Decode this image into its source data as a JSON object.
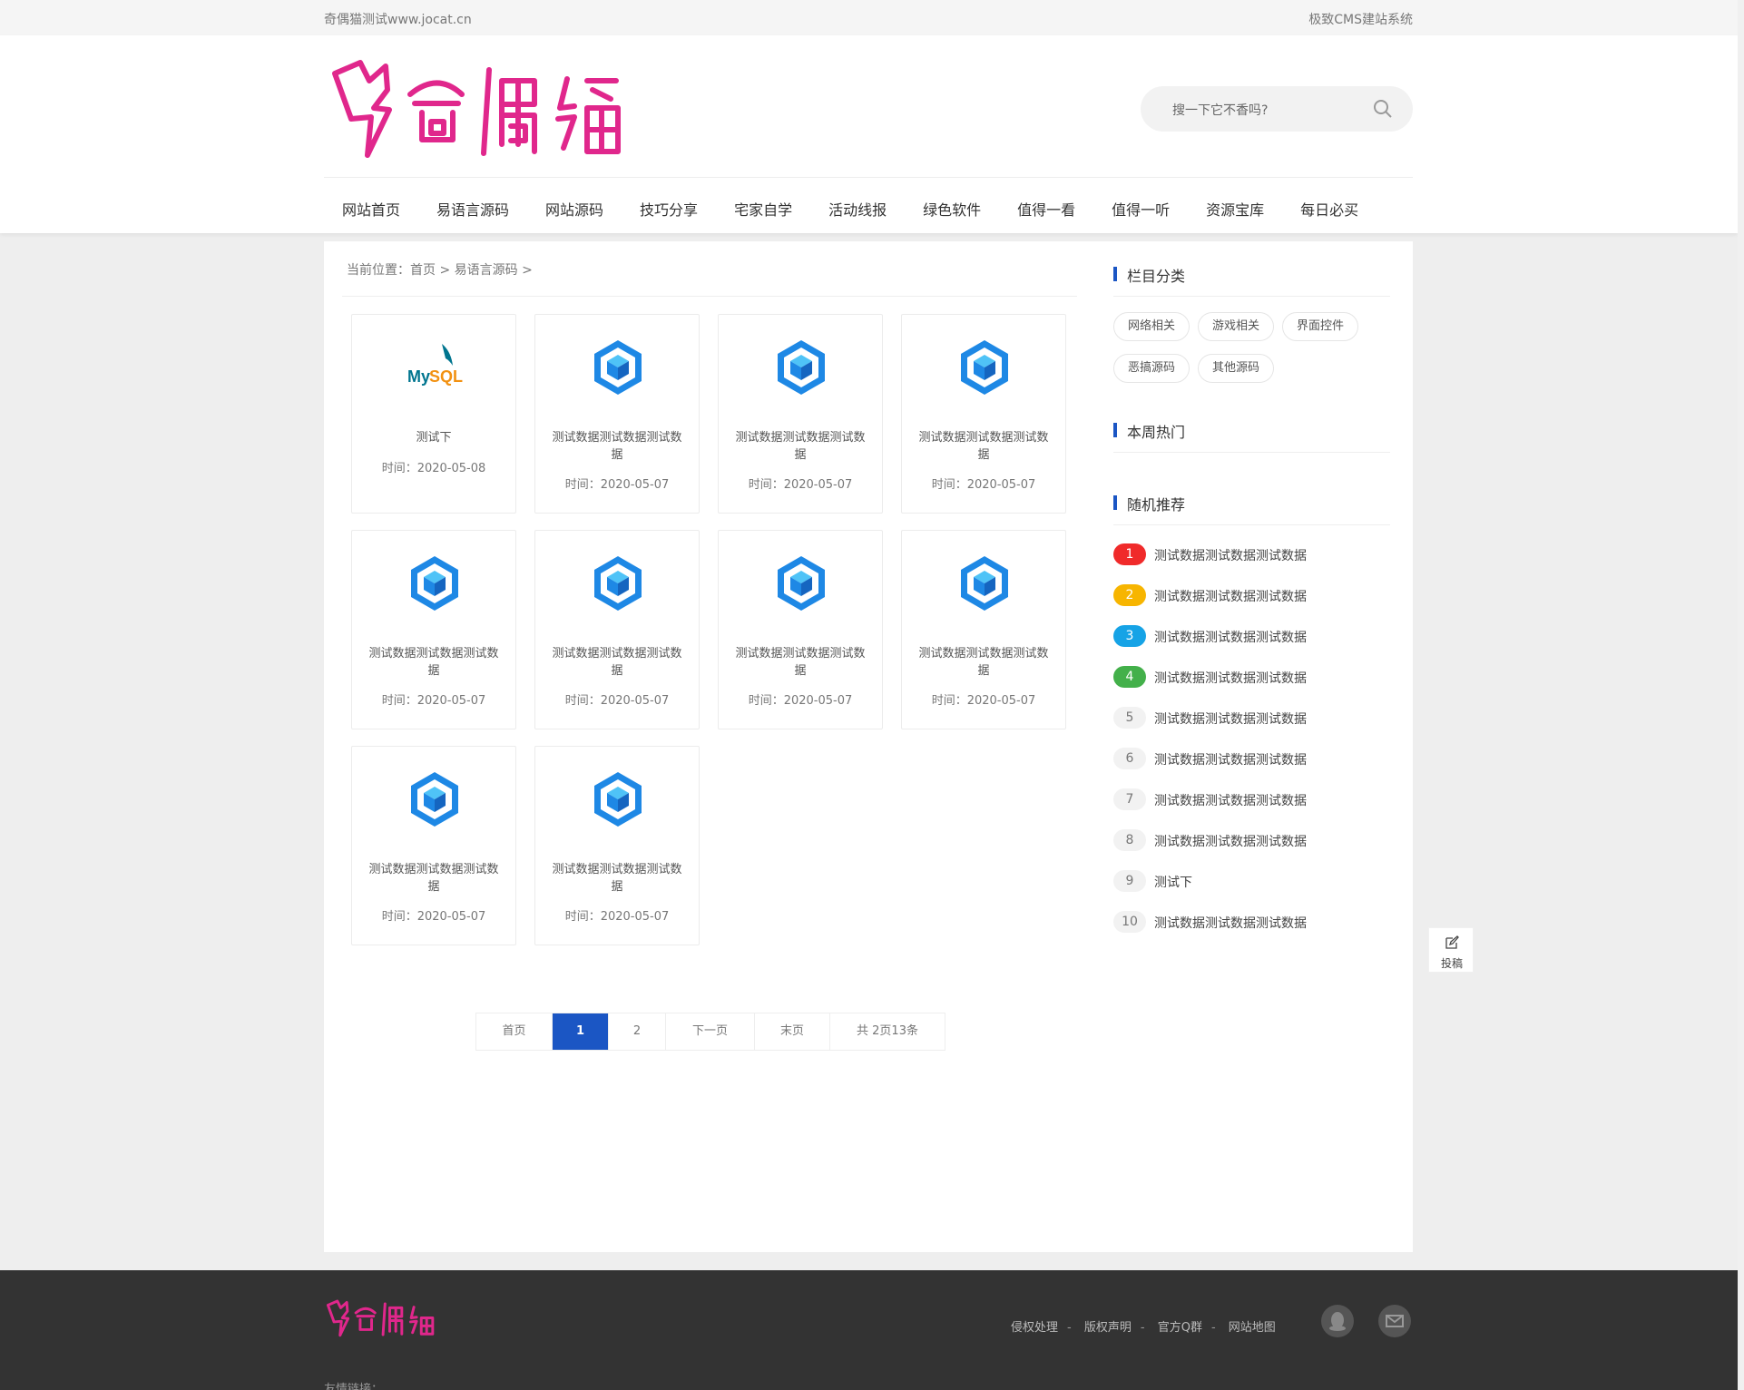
{
  "topbar": {
    "left": "奇偶猫测试www.jocat.cn",
    "right": "极致CMS建站系统"
  },
  "search": {
    "placeholder": "搜一下它不香吗?"
  },
  "nav": [
    "网站首页",
    "易语言源码",
    "网站源码",
    "技巧分享",
    "宅家自学",
    "活动线报",
    "绿色软件",
    "值得一看",
    "值得一听",
    "资源宝库",
    "每日必买"
  ],
  "breadcrumb": "当前位置：首页 > 易语言源码 >",
  "cards": [
    {
      "icon": "mysql-logo",
      "title": "测试下",
      "time": "时间：2020-05-08"
    },
    {
      "icon": "cube-icon",
      "title": "测试数据测试数据测试数据",
      "time": "时间：2020-05-07"
    },
    {
      "icon": "cube-icon",
      "title": "测试数据测试数据测试数据",
      "time": "时间：2020-05-07"
    },
    {
      "icon": "cube-icon",
      "title": "测试数据测试数据测试数据",
      "time": "时间：2020-05-07"
    },
    {
      "icon": "cube-icon",
      "title": "测试数据测试数据测试数据",
      "time": "时间：2020-05-07"
    },
    {
      "icon": "cube-icon",
      "title": "测试数据测试数据测试数据",
      "time": "时间：2020-05-07"
    },
    {
      "icon": "cube-icon",
      "title": "测试数据测试数据测试数据",
      "time": "时间：2020-05-07"
    },
    {
      "icon": "cube-icon",
      "title": "测试数据测试数据测试数据",
      "time": "时间：2020-05-07"
    },
    {
      "icon": "cube-icon",
      "title": "测试数据测试数据测试数据",
      "time": "时间：2020-05-07"
    },
    {
      "icon": "cube-icon",
      "title": "测试数据测试数据测试数据",
      "time": "时间：2020-05-07"
    }
  ],
  "pager": {
    "first": "首页",
    "p1": "1",
    "p2": "2",
    "next": "下一页",
    "last": "末页",
    "total": "共 2页13条"
  },
  "sidebar": {
    "category_title": "栏目分类",
    "tags": [
      "网络相关",
      "游戏相关",
      "界面控件",
      "恶搞源码",
      "其他源码"
    ],
    "hot_title": "本周热门",
    "random_title": "随机推荐",
    "random_items": [
      {
        "num": "1",
        "text": "测试数据测试数据测试数据",
        "color": "#f02a2a"
      },
      {
        "num": "2",
        "text": "测试数据测试数据测试数据",
        "color": "#f7b500"
      },
      {
        "num": "3",
        "text": "测试数据测试数据测试数据",
        "color": "#16a3e6"
      },
      {
        "num": "4",
        "text": "测试数据测试数据测试数据",
        "color": "#43b04a"
      },
      {
        "num": "5",
        "text": "测试数据测试数据测试数据",
        "color": ""
      },
      {
        "num": "6",
        "text": "测试数据测试数据测试数据",
        "color": ""
      },
      {
        "num": "7",
        "text": "测试数据测试数据测试数据",
        "color": ""
      },
      {
        "num": "8",
        "text": "测试数据测试数据测试数据",
        "color": ""
      },
      {
        "num": "9",
        "text": "测试下",
        "color": ""
      },
      {
        "num": "10",
        "text": "测试数据测试数据测试数据",
        "color": ""
      }
    ]
  },
  "float_button": {
    "label": "投稿",
    "icon": "edit-icon"
  },
  "footer": {
    "links": [
      "侵权处理",
      "版权声明",
      "官方Q群",
      "网站地图"
    ],
    "separator": "-",
    "icons": [
      "qq-icon",
      "mail-icon"
    ],
    "friend_links": "友情链接："
  },
  "colors": {
    "accent": "#1b56c4",
    "brand_pink": "#e0278c"
  }
}
